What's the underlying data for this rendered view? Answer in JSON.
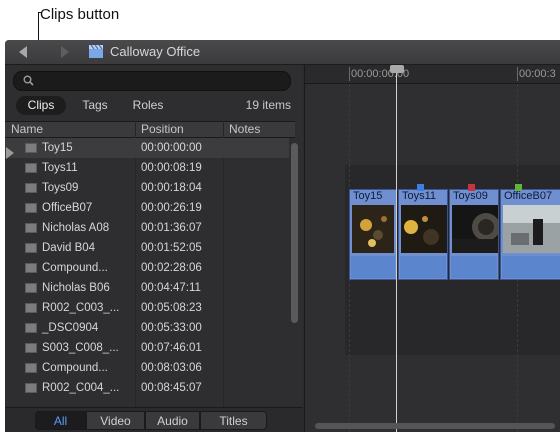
{
  "callout": {
    "label": "Clips button"
  },
  "titlebar": {
    "title": "Calloway Office"
  },
  "search": {
    "placeholder": ""
  },
  "filter_tabs": {
    "clips": "Clips",
    "tags": "Tags",
    "roles": "Roles",
    "count": "19 items"
  },
  "columns": {
    "name": "Name",
    "position": "Position",
    "notes": "Notes"
  },
  "rows": [
    {
      "name": "Toy15",
      "position": "00:00:00:00"
    },
    {
      "name": "Toys11",
      "position": "00:00:08:19"
    },
    {
      "name": "Toys09",
      "position": "00:00:18:04"
    },
    {
      "name": "OfficeB07",
      "position": "00:00:26:19"
    },
    {
      "name": "Nicholas A08",
      "position": "00:01:36:07"
    },
    {
      "name": "David B04",
      "position": "00:01:52:05"
    },
    {
      "name": "Compound...",
      "position": "00:02:28:06"
    },
    {
      "name": "Nicholas B06",
      "position": "00:04:47:11"
    },
    {
      "name": "R002_C003_...",
      "position": "00:05:08:23"
    },
    {
      "name": "_DSC0904",
      "position": "00:05:33:00"
    },
    {
      "name": "S003_C008_...",
      "position": "00:07:46:01"
    },
    {
      "name": "Compound...",
      "position": "00:08:03:06"
    },
    {
      "name": "R002_C004_...",
      "position": "00:08:45:07"
    }
  ],
  "bottom_filters": {
    "all": "All",
    "video": "Video",
    "audio": "Audio",
    "titles": "Titles"
  },
  "timeline": {
    "ruler": [
      "00:00:00:00",
      "00:00:3"
    ],
    "clips": [
      {
        "name": "Toy15",
        "marker": null
      },
      {
        "name": "Toys11",
        "marker": "#3f7fe0"
      },
      {
        "name": "Toys09",
        "marker": "#c8343c"
      },
      {
        "name": "OfficeB07",
        "marker": "#63b43a"
      }
    ]
  },
  "colors": {
    "accent": "#5a9cf5",
    "clip": "#6f8fd0"
  }
}
